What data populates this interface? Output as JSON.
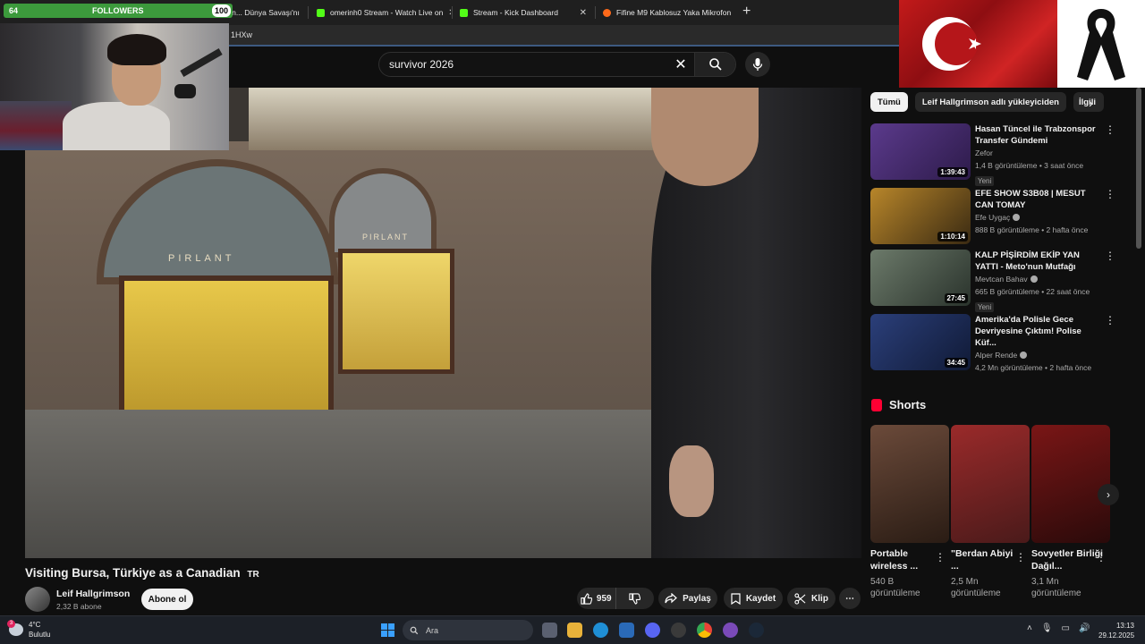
{
  "browser": {
    "tabs": [
      {
        "label": "Bu Ada Neden... Dünya Savaşı'nı B",
        "favicon": "youtube-icon",
        "color": "#ff0000"
      },
      {
        "label": "omerinh0 Stream - Watch Live on",
        "favicon": "kick-icon",
        "color": "#53fc18"
      },
      {
        "label": "Stream - Kick Dashboard",
        "favicon": "kick-icon",
        "color": "#53fc18"
      },
      {
        "label": "Fifine M9 Kablosuz Yaka Mikrofon",
        "favicon": "shop-icon",
        "color": "#ff6a1a"
      }
    ],
    "address_fragment": "1HXw"
  },
  "overlay": {
    "followers_count": "64",
    "followers_label": "FOLLOWERS",
    "followers_goal": "100"
  },
  "search": {
    "query": "survivor 2026"
  },
  "video": {
    "title": "Visiting Bursa, Türkiye as a Canadian",
    "title_flag": "TR",
    "shop_sign_1": "PIRLANT",
    "shop_sign_2": "PIRLANT",
    "channel": "Leif Hallgrimson",
    "subscribers": "2,32 B abone",
    "subscribe_label": "Abone ol",
    "likes": "959",
    "share_label": "Paylaş",
    "save_label": "Kaydet",
    "clip_label": "Klip"
  },
  "sidebar": {
    "chips": [
      "Tümü",
      "Leif Hallgrimson adlı yükleyiciden",
      "İlgili"
    ],
    "recommended": [
      {
        "title": "Hasan Tüncel ile Trabzonspor Transfer Gündemi",
        "channel": "Zefor",
        "verified": false,
        "views": "1,4 B görüntüleme",
        "age": "3 saat önce",
        "badge": "Yeni",
        "duration": "1:39:43",
        "thumb_color": "#5b3a8c"
      },
      {
        "title": "EFE SHOW S3B08 | MESUT CAN TOMAY",
        "channel": "Efe Uygaç",
        "verified": true,
        "views": "888 B görüntüleme",
        "age": "2 hafta önce",
        "badge": "",
        "duration": "1:10:14",
        "thumb_color": "#b8862a"
      },
      {
        "title": "KALP PİŞİRDİM EKİP YAN YATTI - Meto'nun Mutfağı",
        "channel": "Mevtcan Bahav",
        "verified": true,
        "views": "665 B görüntüleme",
        "age": "22 saat önce",
        "badge": "Yeni",
        "duration": "27:45",
        "thumb_color": "#6c7a6a"
      },
      {
        "title": "Amerika'da Polisle Gece Devriyesine Çıktım! Polise Küf...",
        "channel": "Alper Rende",
        "verified": true,
        "views": "4,2 Mn görüntüleme",
        "age": "2 hafta önce",
        "badge": "",
        "duration": "34:45",
        "thumb_color": "#2b3f7a"
      }
    ],
    "shorts_heading": "Shorts",
    "shorts": [
      {
        "title": "Portable wireless ...",
        "views": "540 B görüntüleme",
        "thumb_color": "#6b4a3a"
      },
      {
        "title": "\"Berdan Abiyi ...",
        "views": "2,5 Mn görüntüleme",
        "thumb_color": "#9a2a2a"
      },
      {
        "title": "Sovyetler Birliği Dağıl...",
        "views": "3,1 Mn görüntüleme",
        "thumb_color": "#7a1616"
      }
    ]
  },
  "taskbar": {
    "weather_temp": "4°C",
    "weather_desc": "Bulutlu",
    "weather_badge": "3",
    "search_placeholder": "Ara",
    "time": "13:13",
    "date": "29.12.2025"
  }
}
